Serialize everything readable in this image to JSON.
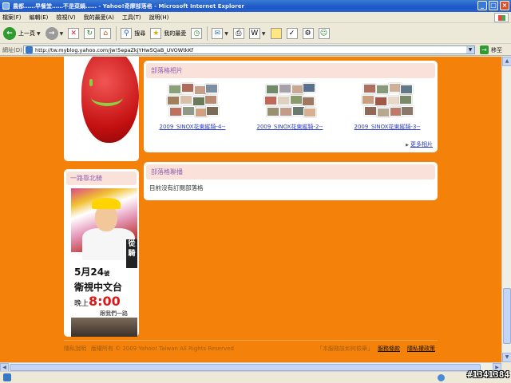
{
  "window": {
    "title": "農都……早餐堂……不是菜鍋…… - Yahoo!奇摩部落格 - Microsoft Internet Explorer",
    "controls": [
      "_",
      "□",
      "×"
    ]
  },
  "menubar": [
    "檔案(F)",
    "編輯(E)",
    "檢視(V)",
    "我的最愛(A)",
    "工具(T)",
    "說明(H)"
  ],
  "toolbar": {
    "back": "上一頁",
    "search": "搜尋",
    "favorites": "我的最愛"
  },
  "address": {
    "label": "網址(D)",
    "url": "http://tw.myblog.yahoo.com/jw!5epaZkjYHw5QaB_UVOWtkKf",
    "go": "移至"
  },
  "sidebar": {
    "subscribe_card_title": "一路靠北騎",
    "ad": {
      "badge": "從騎",
      "date": "5月24",
      "date_suffix": "號",
      "channel": "衛視中文台",
      "time_prefix": "晚上",
      "time": "8:00",
      "follow": "跟我們一路"
    }
  },
  "album_panel": {
    "title": "部落格相片",
    "albums": [
      {
        "title": "2009_SINOX花東縱騎-4--"
      },
      {
        "title": "2009_SINOX花東縱騎-2--"
      },
      {
        "title": "2009_SINOX花東縱騎-3--"
      }
    ],
    "more": "更多相片"
  },
  "subscription_panel": {
    "title": "部落格聯播",
    "empty_text": "目前沒有訂閱部落格"
  },
  "footer": {
    "link1": "隱私說明",
    "copyright": "版權所有 © 2009 Yahoo! Taiwan All Rights Reserved",
    "report": "「本服務該如何檢舉」",
    "terms": "服務條款",
    "privacy": "隱私權政策"
  },
  "watermark": "#1341384",
  "colors": {
    "page_background": "#f4820a",
    "panel_header": "#fae1da",
    "panel_header_text": "#8f62b3",
    "link": "#2b3bc9"
  }
}
